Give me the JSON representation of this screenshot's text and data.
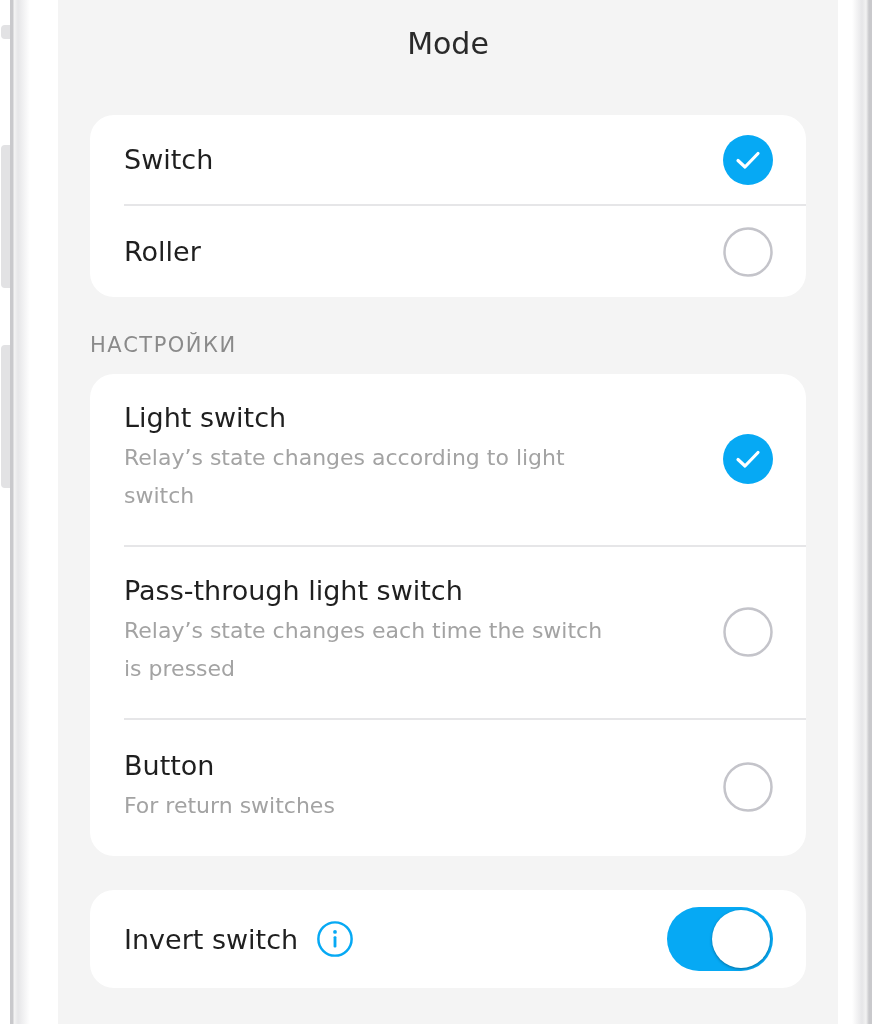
{
  "title": "Mode",
  "groups": [
    {
      "items": [
        {
          "label": "Switch",
          "selected": true
        },
        {
          "label": "Roller",
          "selected": false
        }
      ]
    },
    {
      "section": "НАСТРОЙКИ",
      "items": [
        {
          "label": "Light switch",
          "description": "Relay’s state changes according to light switch",
          "selected": true
        },
        {
          "label": "Pass-through light switch",
          "description": "Relay’s state changes each time the switch is pressed",
          "selected": false
        },
        {
          "label": "Button",
          "description": "For return switches",
          "selected": false
        }
      ]
    }
  ],
  "toggle": {
    "label": "Invert switch",
    "on": true
  }
}
